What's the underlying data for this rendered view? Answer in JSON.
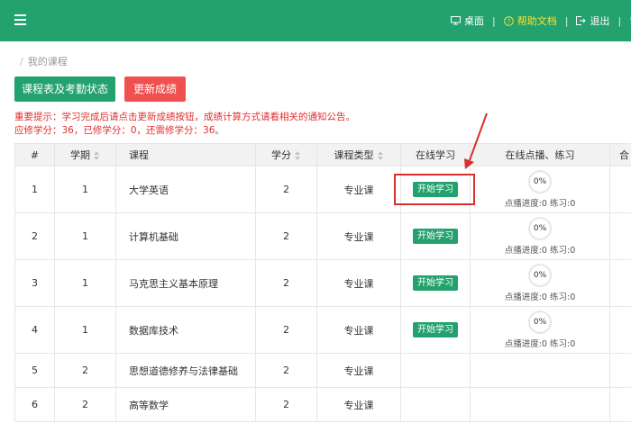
{
  "header": {
    "desktop_label": "桌面",
    "help_label": "帮助文档",
    "logout_label": "退出",
    "separator": "|",
    "accent_color": "#23a26d",
    "help_color": "#f5e13a"
  },
  "breadcrumb": {
    "separator": "/",
    "current": "我的课程"
  },
  "buttons": {
    "schedule_label": "课程表及考勤状态",
    "refresh_label": "更新成绩"
  },
  "notice": {
    "line1": "重要提示：学习完成后请点击更新成绩按钮，成绩计算方式请看相关的通知公告。",
    "line2": "应修学分：36，已修学分：0，还需修学分：36。"
  },
  "table": {
    "headers": {
      "index": "#",
      "term": "学期",
      "course": "课程",
      "credit": "学分",
      "type": "课程类型",
      "online": "在线学习",
      "progress": "在线点播、练习",
      "extra": "合"
    },
    "rows": [
      {
        "index": "1",
        "term": "1",
        "course": "大学英语",
        "credit": "2",
        "type": "专业课",
        "action": "开始学习",
        "percent": "0%",
        "progress_text": "点播进度:0 练习:0"
      },
      {
        "index": "2",
        "term": "1",
        "course": "计算机基础",
        "credit": "2",
        "type": "专业课",
        "action": "开始学习",
        "percent": "0%",
        "progress_text": "点播进度:0 练习:0"
      },
      {
        "index": "3",
        "term": "1",
        "course": "马克思主义基本原理",
        "credit": "2",
        "type": "专业课",
        "action": "开始学习",
        "percent": "0%",
        "progress_text": "点播进度:0 练习:0"
      },
      {
        "index": "4",
        "term": "1",
        "course": "数据库技术",
        "credit": "2",
        "type": "专业课",
        "action": "开始学习",
        "percent": "0%",
        "progress_text": "点播进度:0 练习:0"
      },
      {
        "index": "5",
        "term": "2",
        "course": "思想道德修养与法律基础",
        "credit": "2",
        "type": "专业课"
      },
      {
        "index": "6",
        "term": "2",
        "course": "高等数学",
        "credit": "2",
        "type": "专业课"
      }
    ]
  },
  "annotation": {
    "highlight_color": "#d9302c"
  }
}
